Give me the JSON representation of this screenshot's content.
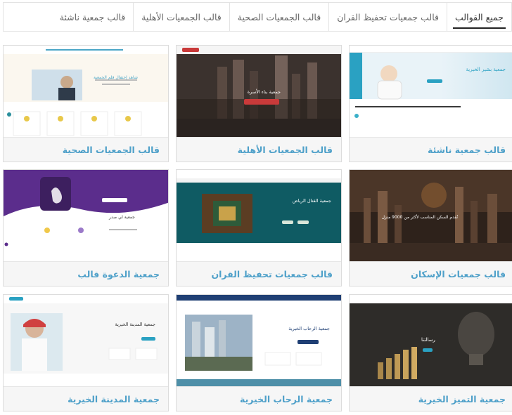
{
  "tabs": [
    {
      "label": "جميع القوالب",
      "active": true
    },
    {
      "label": "قالب جمعيات تحفيظ القران",
      "active": false
    },
    {
      "label": "قالب الجمعيات الصحية",
      "active": false
    },
    {
      "label": "قالب الجمعيات الأهلية",
      "active": false
    },
    {
      "label": "قالب جمعية ناشئة",
      "active": false
    }
  ],
  "cards": [
    {
      "label": "قالب جمعية ناشئة",
      "hero": "جمعية بشير الخيرية"
    },
    {
      "label": "قالب الجمعيات الأهلية",
      "hero": "جمعية بناء الأسرة"
    },
    {
      "label": "قالب الجمعيات الصحية",
      "hero": "شاهد إحتفال فلم الجمعية"
    },
    {
      "label": "قالب جمعيات الإسكان",
      "hero": "نُقدم السكن المناسب لأكثر من 9000 منزل"
    },
    {
      "label": "قالب جمعيات تحفيظ القران",
      "hero": "جمعية القتال الرياض"
    },
    {
      "label": "جمعية الدعوة قالب",
      "hero": "جمعية لي صدر"
    },
    {
      "label": "جمعية التميز الخيرية",
      "hero": "رسالتنا"
    },
    {
      "label": "جمعية الرحاب الخيرية",
      "hero": "جمعية الرحاب الخيرية"
    },
    {
      "label": "جمعية المدينة الخيرية",
      "hero": "جمعية المدينة الخيرية"
    }
  ],
  "colors": {
    "accent": "#4ea0c9",
    "tab_text": "#666666",
    "active_underline": "#222222",
    "label_bar": "#f6f6f6"
  }
}
